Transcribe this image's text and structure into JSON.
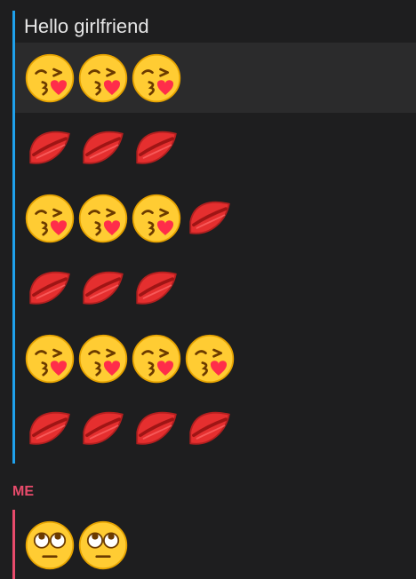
{
  "thread": {
    "received_text": "Hello girlfriend",
    "received_rows": [
      [
        "kissing-face",
        "kissing-face",
        "kissing-face"
      ],
      [
        "lips",
        "lips",
        "lips"
      ],
      [
        "kissing-face",
        "kissing-face",
        "kissing-face",
        "lips"
      ],
      [
        "lips",
        "lips",
        "lips"
      ],
      [
        "kissing-face",
        "kissing-face",
        "kissing-face",
        "kissing-face"
      ],
      [
        "lips",
        "lips",
        "lips",
        "lips"
      ]
    ],
    "sent_label": "ME",
    "sent_row": [
      "eye-roll-face",
      "eye-roll-face"
    ]
  },
  "colors": {
    "background": "#1e1e1f",
    "received_bar": "#1fa1ec",
    "sent_bar": "#e84b6b",
    "highlight": "#2b2b2c"
  }
}
